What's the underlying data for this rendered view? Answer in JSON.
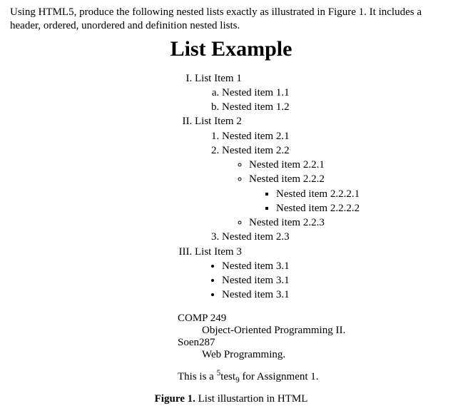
{
  "instructions": "Using HTML5, produce the following nested lists exactly as illustrated in Figure 1. It includes a header, ordered, unordered and definition nested lists.",
  "heading": "List Example",
  "list": {
    "i1": "List Item 1",
    "i1a": "Nested item 1.1",
    "i1b": "Nested item 1.2",
    "i2": "List Item 2",
    "i2_1": "Nested item 2.1",
    "i2_2": "Nested item 2.2",
    "i2_2_1": "Nested item 2.2.1",
    "i2_2_2": "Nested item 2.2.2",
    "i2_2_2_1": "Nested item 2.2.2.1",
    "i2_2_2_2": "Nested item 2.2.2.2",
    "i2_2_3": "Nested item 2.2.3",
    "i2_3": "Nested item 2.3",
    "i3": "List Item 3",
    "i3_1": "Nested item 3.1",
    "i3_2": "Nested item 3.1",
    "i3_3": "Nested item 3.1"
  },
  "dl": {
    "t1": "COMP 249",
    "d1": "Object-Oriented Programming II.",
    "t2": "Soen287",
    "d2": "Web Programming."
  },
  "supline": {
    "pre": "This is a ",
    "sup": "5",
    "mid": "test",
    "sub": "9",
    "post": " for Assignment 1."
  },
  "caption": {
    "label": "Figure 1.",
    "text": " List illustartion in HTML"
  }
}
